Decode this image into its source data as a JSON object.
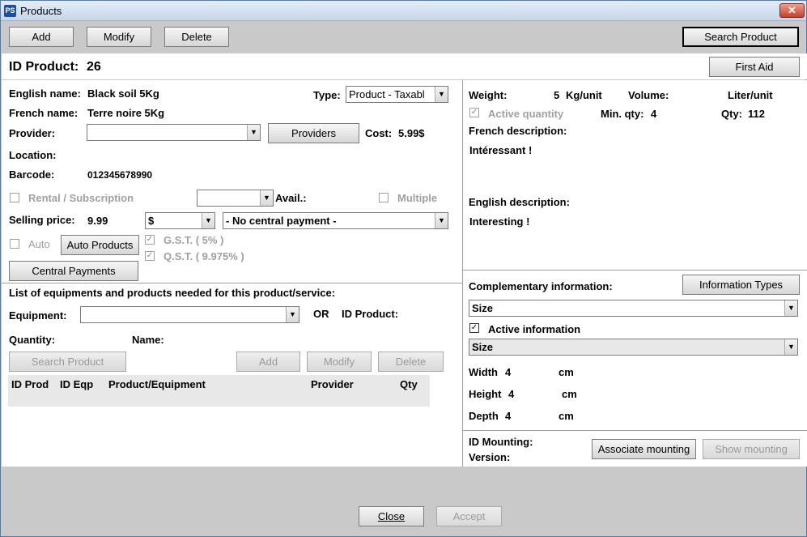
{
  "window": {
    "title": "Products",
    "icon": "PS",
    "close": "✕"
  },
  "toolbar": {
    "add": "Add",
    "modify": "Modify",
    "delete": "Delete",
    "search_product": "Search Product",
    "first_aid": "First Aid"
  },
  "header": {
    "id_label": "ID Product:",
    "id_value": "26"
  },
  "left": {
    "english_name_label": "English name:",
    "english_name": "Black soil 5Kg",
    "french_name_label": "French name:",
    "french_name": "Terre noire 5Kg",
    "type_label": "Type:",
    "type_value": "Product - Taxabl",
    "provider_label": "Provider:",
    "provider_value": "",
    "providers_button": "Providers",
    "cost_label": "Cost:",
    "cost_value": "5.99$",
    "location_label": "Location:",
    "barcode_label": "Barcode:",
    "barcode_value": "012345678990",
    "rental_label": "Rental / Subscription",
    "avail_label": "Avail.:",
    "avail_value": "",
    "multiple_label": "Multiple",
    "selling_price_label": "Selling price:",
    "selling_price": "9.99",
    "currency": "$",
    "central_payment_value": "- No central payment -",
    "auto_label": "Auto",
    "auto_products_button": "Auto Products",
    "gst_label": "G.S.T.  ( 5% )",
    "qst_label": "Q.S.T.  ( 9.975% )",
    "central_payments_button": "Central Payments"
  },
  "equipment": {
    "heading": "List of equipments and products needed for this product/service:",
    "equipment_label": "Equipment:",
    "equipment_value": "",
    "or_label": "OR",
    "id_product_label": "ID Product:",
    "quantity_label": "Quantity:",
    "name_label": "Name:",
    "search_product_button": "Search Product",
    "add_button": "Add",
    "modify_button": "Modify",
    "delete_button": "Delete",
    "columns": [
      "ID Prod",
      "ID Eqp",
      "Product/Equipment",
      "Provider",
      "Qty"
    ]
  },
  "right": {
    "weight_label": "Weight:",
    "weight_value": "5",
    "weight_unit": "Kg/unit",
    "volume_label": "Volume:",
    "volume_unit": "Liter/unit",
    "active_quantity_label": "Active quantity",
    "min_qty_label": "Min. qty:",
    "min_qty_value": "4",
    "qty_label": "Qty:",
    "qty_value": "112",
    "french_desc_label": "French description:",
    "french_desc": "Intéressant !",
    "english_desc_label": "English description:",
    "english_desc": "Interesting !"
  },
  "complementary": {
    "label": "Complementary information:",
    "info_types_button": "Information Types",
    "type_select": "Size",
    "active_info_label": "Active information",
    "value_select": "Size",
    "width_label": "Width",
    "width_value": "4",
    "width_unit": "cm",
    "height_label": "Height",
    "height_value": "4",
    "height_unit": "cm",
    "depth_label": "Depth",
    "depth_value": "4",
    "depth_unit": "cm"
  },
  "mounting": {
    "id_label": "ID Mounting:",
    "version_label": "Version:",
    "associate_button": "Associate mounting",
    "show_button": "Show mounting"
  },
  "footer": {
    "close_button": "Close",
    "accept_button": "Accept"
  }
}
